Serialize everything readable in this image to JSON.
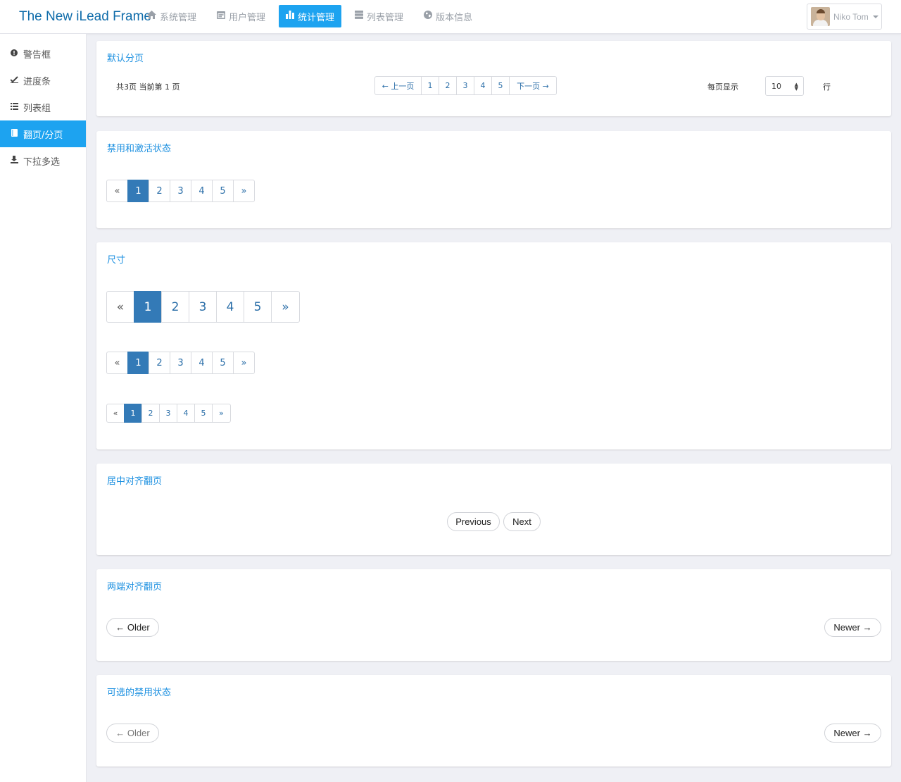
{
  "app": {
    "title": "The New iLead Frame"
  },
  "nav": [
    {
      "label": "系统管理",
      "icon": "home-icon"
    },
    {
      "label": "用户管理",
      "icon": "calendar-icon"
    },
    {
      "label": "统计管理",
      "icon": "bar-chart-icon",
      "active": true
    },
    {
      "label": "列表管理",
      "icon": "server-icon"
    },
    {
      "label": "版本信息",
      "icon": "globe-icon"
    }
  ],
  "user": {
    "name": "Niko Tom"
  },
  "sidebar": [
    {
      "label": "警告框",
      "icon": "exclamation-circle-icon"
    },
    {
      "label": "进度条",
      "icon": "check-mark-icon"
    },
    {
      "label": "列表组",
      "icon": "list-icon"
    },
    {
      "label": "翻页/分页",
      "icon": "book-icon",
      "active": true
    },
    {
      "label": "下拉多选",
      "icon": "tray-icon"
    }
  ],
  "panels": {
    "default": {
      "title": "默认分页",
      "info": "共3页 当前第 1 页",
      "prev": "← 上一页",
      "next": "下一页 →",
      "pages": [
        "1",
        "2",
        "3",
        "4",
        "5"
      ],
      "per_page_label": "每页显示",
      "per_page_value": "10",
      "rows_label": "行"
    },
    "states": {
      "title": "禁用和激活状态",
      "first": "«",
      "last": "»",
      "pages": [
        "1",
        "2",
        "3",
        "4",
        "5"
      ]
    },
    "sizes": {
      "title": "尺寸",
      "first": "«",
      "last": "»",
      "pages": [
        "1",
        "2",
        "3",
        "4",
        "5"
      ]
    },
    "centered": {
      "title": "居中对齐翻页",
      "previous": "Previous",
      "next": "Next"
    },
    "justified": {
      "title": "两端对齐翻页",
      "older": "← Older",
      "newer": "Newer →"
    },
    "optional_disabled": {
      "title": "可选的禁用状态",
      "older": "← Older",
      "newer": "Newer →"
    }
  },
  "colors": {
    "accent": "#1da3f0",
    "active_page": "#337ab7",
    "brand": "#0f6caa",
    "panel_title": "#1a8fe0"
  }
}
